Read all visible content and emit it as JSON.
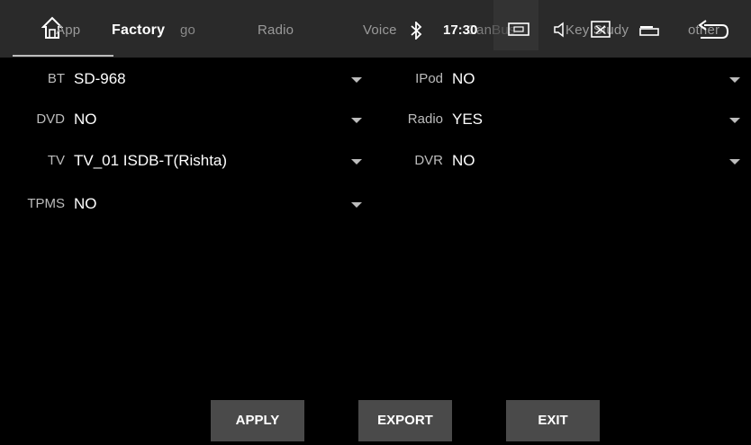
{
  "topbar": {
    "tabs": [
      {
        "label": "App"
      },
      {
        "label": "Factory"
      },
      {
        "label": "Radio"
      },
      {
        "label": "Voice"
      },
      {
        "label": "CanBus"
      },
      {
        "label": "Key Study"
      },
      {
        "label": "other"
      }
    ],
    "overlay_logo_text": "go",
    "time": "17:30"
  },
  "settings": {
    "bt": {
      "label": "BT",
      "value": "SD-968"
    },
    "ipod": {
      "label": "IPod",
      "value": "NO"
    },
    "dvd": {
      "label": "DVD",
      "value": "NO"
    },
    "radio": {
      "label": "Radio",
      "value": "YES"
    },
    "tv": {
      "label": "TV",
      "value": "TV_01 ISDB-T(Rishta)"
    },
    "dvr": {
      "label": "DVR",
      "value": "NO"
    },
    "tpms": {
      "label": "TPMS",
      "value": "NO"
    }
  },
  "buttons": {
    "apply": "APPLY",
    "export": "EXPORT",
    "exit": "EXIT"
  }
}
